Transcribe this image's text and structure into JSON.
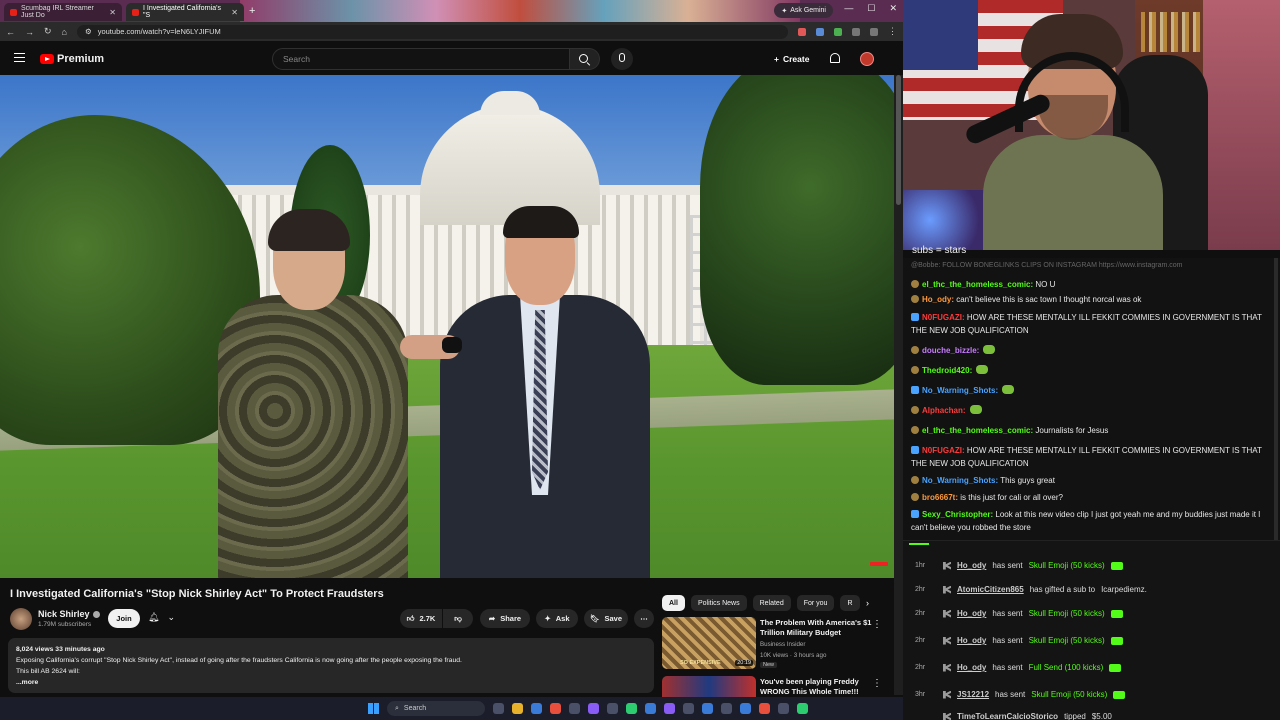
{
  "browser": {
    "tabs": [
      {
        "label": "Scumbag IRL Streamer Just Do"
      },
      {
        "label": "I Investigated California's \"S"
      }
    ],
    "ask_gemini": "Ask Gemini",
    "url": "youtube.com/watch?v=leN6LYJIFUM"
  },
  "yt_header": {
    "brand": "Premium",
    "search_placeholder": "Search",
    "create_label": "Create"
  },
  "video": {
    "title": "I Investigated California's \"Stop Nick Shirley Act\" To Protect Fraudsters",
    "channel_name": "Nick Shirley",
    "subscribers": "1.79M subscribers",
    "join_label": "Join",
    "likes": "2.7K",
    "share_label": "Share",
    "ask_label": "Ask",
    "save_label": "Save",
    "meta": "8,024 views  33 minutes ago",
    "description_line1": "Exposing California's corrupt \"Stop Nick Shirley Act\", instead of going after the fraudsters California is now going after the people exposing the fraud.",
    "description_line2": "This bill AB 2624 will:",
    "more_label": "...more"
  },
  "chips": [
    "All",
    "Politics News",
    "Related",
    "For you",
    "R"
  ],
  "recommendations": [
    {
      "title": "The Problem With America's $1 Trillion Military Budget",
      "channel": "Business Insider",
      "meta": "10K views · 3 hours ago",
      "badge": "New",
      "thumb_label": "SO EXPENSIVE",
      "duration": "20:19"
    },
    {
      "title": "You've been playing Freddy WRONG This Whole Time!!!",
      "channel": "",
      "meta": "",
      "badge": "",
      "thumb_label": "",
      "duration": ""
    }
  ],
  "taskbar": {
    "search_label": "Search"
  },
  "stream": {
    "overlay_text": "subs = stars"
  },
  "chat": {
    "faded_top": "@Bobbe: FOLLOW BONEGLINKS CLIPS ON INSTAGRAM https://www.instagram.com",
    "messages": [
      {
        "user": "el_thc_the_homeless_comic:",
        "user_color": "#53fc18",
        "text": "NO U"
      },
      {
        "user": "Ho_ody:",
        "user_color": "#ff9a3c",
        "text": "can't believe this is sac town I thought norcal was ok"
      },
      {
        "user": "N0FUGAZI:",
        "user_color": "#ff3b3b",
        "text": "HOW ARE THESE MENTALLY ILL FEKKIT COMMIES IN GOVERNMENT IS THAT THE NEW JOB QUALIFICATION"
      },
      {
        "user": "douche_bizzle:",
        "user_color": "#c77dff",
        "text": ""
      },
      {
        "user": "Thedroid420:",
        "user_color": "#53fc18",
        "text": ""
      },
      {
        "user": "No_Warning_Shots:",
        "user_color": "#4aa3ff",
        "text": ""
      },
      {
        "user": "Alphachan:",
        "user_color": "#ff3b3b",
        "text": ""
      },
      {
        "user": "el_thc_the_homeless_comic:",
        "user_color": "#53fc18",
        "text": "Journalists for Jesus"
      },
      {
        "user": "N0FUGAZI:",
        "user_color": "#ff3b3b",
        "text": "HOW ARE THESE MENTALLY ILL FEKKIT COMMIES IN GOVERNMENT IS THAT THE NEW JOB QUALIFICATION"
      },
      {
        "user": "No_Warning_Shots:",
        "user_color": "#4aa3ff",
        "text": "This guys great"
      },
      {
        "user": "bro6667t:",
        "user_color": "#ff9a3c",
        "text": "is this just for cali or all over?"
      },
      {
        "user": "Sexy_Christopher:",
        "user_color": "#53fc18",
        "text": "Look at this new video clip I just got yeah me and my buddies just made it I can't believe you robbed the store"
      }
    ]
  },
  "events": [
    {
      "time": "1hr",
      "user": "Ho_ody",
      "action": "has sent",
      "item": "Skull Emoji (50 kicks)"
    },
    {
      "time": "2hr",
      "user": "AtomicCitizen865",
      "action": "has gifted a sub to",
      "item": "Icarpediemz."
    },
    {
      "time": "2hr",
      "user": "Ho_ody",
      "action": "has sent",
      "item": "Skull Emoji (50 kicks)"
    },
    {
      "time": "2hr",
      "user": "Ho_ody",
      "action": "has sent",
      "item": "Skull Emoji (50 kicks)"
    },
    {
      "time": "2hr",
      "user": "Ho_ody",
      "action": "has sent",
      "item": "Full Send (100 kicks)"
    },
    {
      "time": "3hr",
      "user": "JS12212",
      "action": "has sent",
      "item": "Skull Emoji (50 kicks)"
    },
    {
      "time": "",
      "user": "TimeToLearnCalcioStorico",
      "action": "tipped",
      "item": "$5.00"
    }
  ]
}
